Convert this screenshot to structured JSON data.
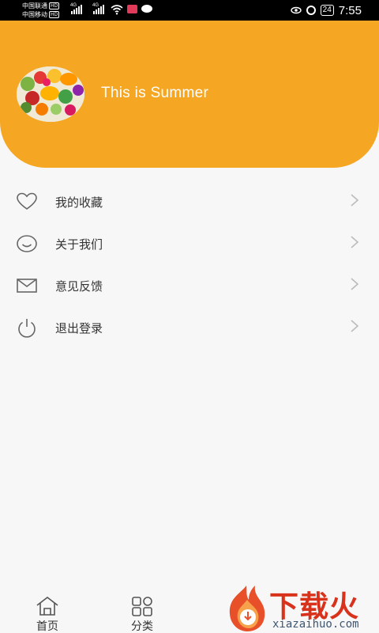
{
  "status_bar": {
    "carrier_1": "中国联通",
    "carrier_2": "中国移动",
    "hd_badge": "HD",
    "network_type": "4G",
    "battery": "24",
    "time": "7:55"
  },
  "profile": {
    "name": "This is Summer",
    "avatar_alt": "fruit-and-vegetable-avatar"
  },
  "menu": {
    "items": [
      {
        "label": "我的收藏",
        "icon": "heart-icon"
      },
      {
        "label": "关于我们",
        "icon": "smile-icon"
      },
      {
        "label": "意见反馈",
        "icon": "mail-icon"
      },
      {
        "label": "退出登录",
        "icon": "power-icon"
      }
    ]
  },
  "bottom_nav": {
    "items": [
      {
        "label": "首页",
        "icon": "home-icon"
      },
      {
        "label": "分类",
        "icon": "category-icon"
      }
    ]
  },
  "watermark": {
    "title": "下载火",
    "subtitle": "xiazaihuo.com"
  },
  "colors": {
    "header": "#f5a623",
    "status_bar": "#000000",
    "background": "#f7f7f7",
    "text": "#333333",
    "icon": "#666666",
    "chevron": "#bbbbbb",
    "watermark_red": "#d8321c"
  }
}
